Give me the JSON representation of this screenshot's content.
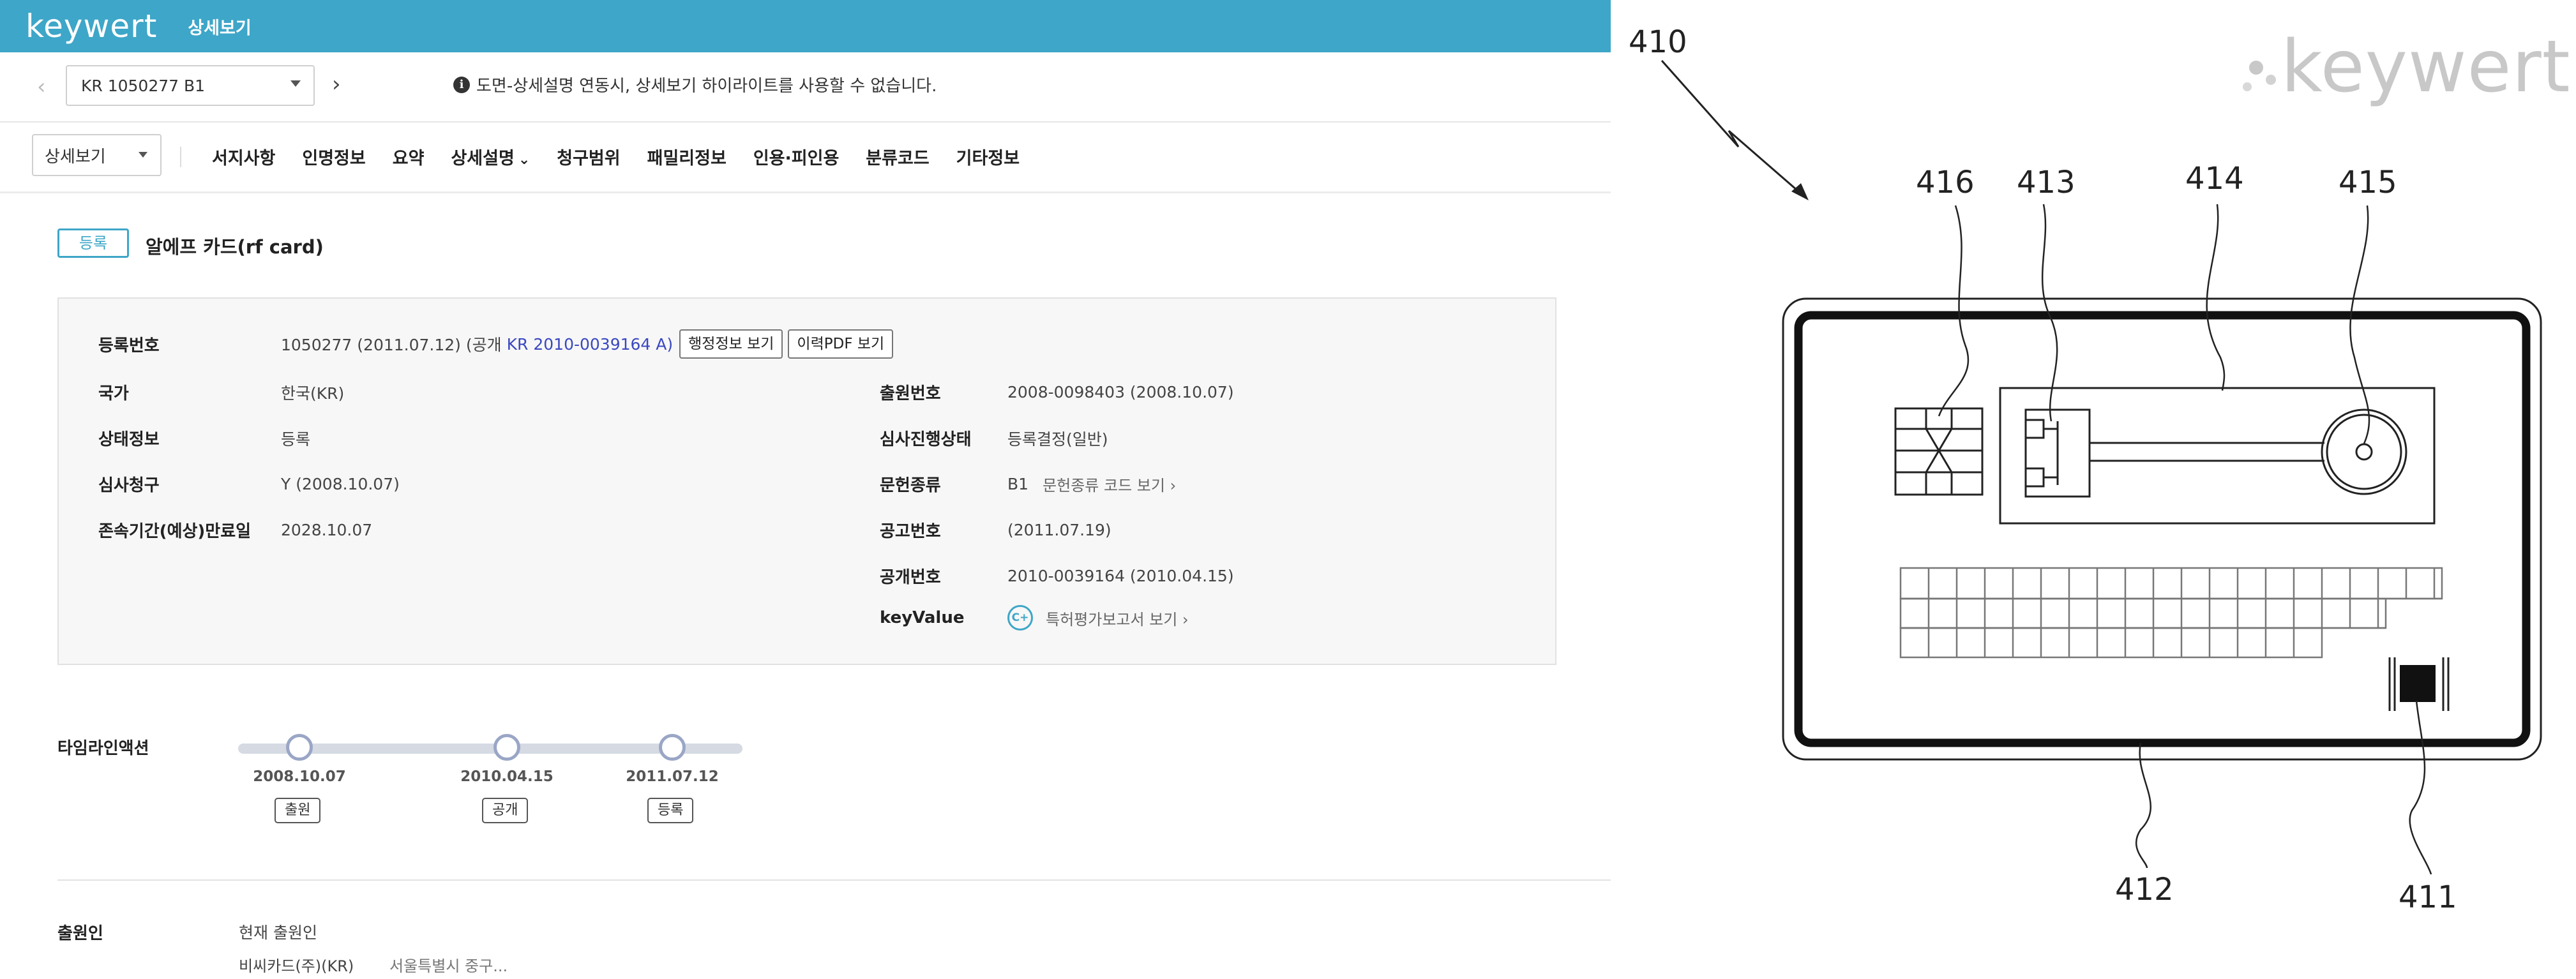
{
  "header": {
    "logo": "keywert",
    "title": "상세보기"
  },
  "nav": {
    "doc_number": "KR 1050277 B1",
    "prev_icon": "chevron-left-icon",
    "next_icon": "chevron-right-icon",
    "notice": "도면-상세설명 연동시, 상세보기 하이라이트를 사용할 수 없습니다."
  },
  "tabs": {
    "view_select": "상세보기",
    "items": [
      "서지사항",
      "인명정보",
      "요약",
      "상세설명",
      "청구범위",
      "패밀리정보",
      "인용·피인용",
      "분류코드",
      "기타정보"
    ]
  },
  "title": {
    "status": "등록",
    "name": "알에프 카드(rf card)"
  },
  "info": {
    "reg_no_label": "등록번호",
    "reg_no_value": "1050277 (2011.07.12) (공개",
    "reg_pub_link": "KR 2010-0039164 A)",
    "btn_admin": "행정정보 보기",
    "btn_history": "이력PDF 보기",
    "country_label": "국가",
    "country_value": "한국(KR)",
    "state_label": "상태정보",
    "state_value": "등록",
    "exam_label": "심사청구",
    "exam_value": "Y (2008.10.07)",
    "expire_label": "존속기간(예상)만료일",
    "expire_value": "2028.10.07",
    "app_no_label": "출원번호",
    "app_no_value": "2008-0098403 (2008.10.07)",
    "exam_status_label": "심사진행상태",
    "exam_status_value": "등록결정(일반)",
    "doc_type_label": "문헌종류",
    "doc_type_value": "B1",
    "doc_type_link": "문헌종류 코드 보기 ›",
    "notice_no_label": "공고번호",
    "notice_no_value": "(2011.07.19)",
    "pub_no_label": "공개번호",
    "pub_no_value": "2010-0039164 (2010.04.15)",
    "keyvalue_label": "keyValue",
    "keyvalue_grade": "C+",
    "keyvalue_link": "특허평가보고서 보기 ›"
  },
  "timeline": {
    "label": "타임라인액션",
    "events": [
      {
        "date": "2008.10.07",
        "tag": "출원"
      },
      {
        "date": "2010.04.15",
        "tag": "공개"
      },
      {
        "date": "2011.07.12",
        "tag": "등록"
      }
    ]
  },
  "applicant": {
    "label": "출원인",
    "current": "현재 출원인",
    "name": "비씨카드(주)(KR)",
    "address": "서울특별시 중구..."
  },
  "drawing": {
    "watermark": "keywert",
    "refs": {
      "r410": "410",
      "r416": "416",
      "r413": "413",
      "r414": "414",
      "r415": "415",
      "r412": "412",
      "r411": "411"
    }
  }
}
